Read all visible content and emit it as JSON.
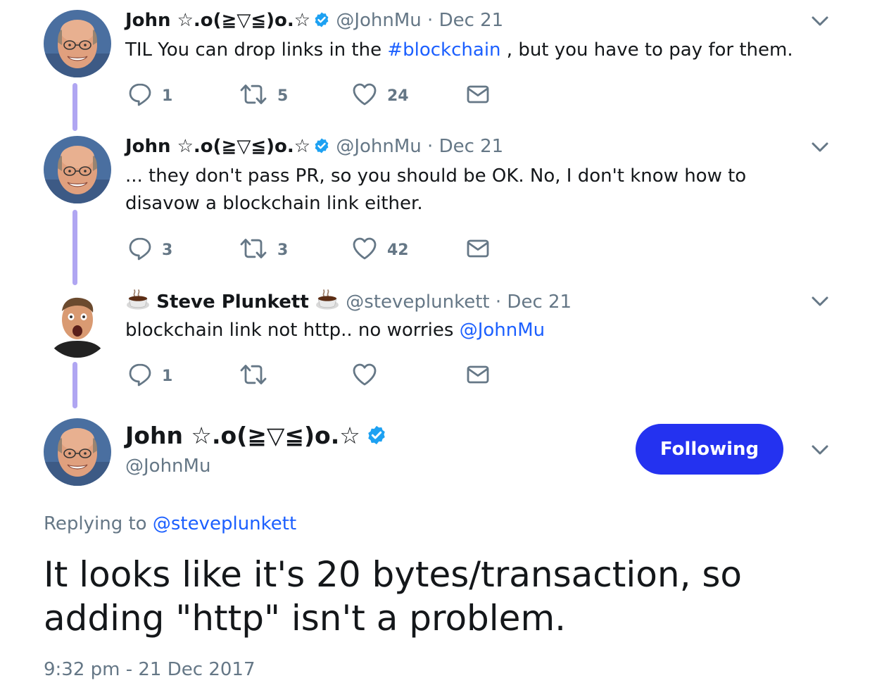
{
  "colors": {
    "accent": "#1b5fff",
    "thread_line": "#b0a6f2",
    "follow_button": "#2432f0",
    "verified": "#1da1f2",
    "muted": "#657786"
  },
  "tweets": [
    {
      "name": "John ☆.o(≧▽≦)o.☆",
      "handle": "@JohnMu",
      "dot": "·",
      "date": "Dec 21",
      "text_before": "TIL You can drop links in the ",
      "hashtag": "#blockchain",
      "text_after": " , but you have to pay for them.",
      "replies": "1",
      "retweets": "5",
      "likes": "24"
    },
    {
      "name": "John ☆.o(≧▽≦)o.☆",
      "handle": "@JohnMu",
      "dot": "·",
      "date": "Dec 21",
      "text": "... they don't pass PR, so you should be OK. No, I don't know how to disavow a blockchain link either.",
      "replies": "3",
      "retweets": "3",
      "likes": "42"
    },
    {
      "name": "Steve Plunkett",
      "handle": "@steveplunkett",
      "dot": "·",
      "date": "Dec 21",
      "text_before": "blockchain link not http.. no worries ",
      "mention": "@JohnMu",
      "replies": "1",
      "retweets": "",
      "likes": ""
    }
  ],
  "main": {
    "name": "John ☆.o(≧▽≦)o.☆",
    "handle": "@JohnMu",
    "follow_label": "Following",
    "replying_prefix": "Replying to ",
    "replying_to": "@steveplunkett",
    "text": "It looks like it's 20 bytes/transaction, so adding \"http\" isn't a problem.",
    "timestamp": "9:32 pm - 21 Dec 2017"
  },
  "icons": {
    "reply": "reply-icon",
    "retweet": "retweet-icon",
    "like": "heart-icon",
    "dm": "envelope-icon",
    "verified": "verified-badge-icon",
    "more": "chevron-down-icon",
    "emoji": "coffee-cup-emoji-icon"
  }
}
